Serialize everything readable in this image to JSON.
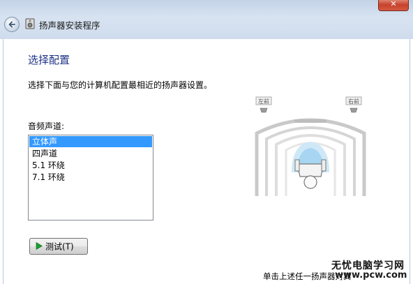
{
  "window": {
    "title": "扬声器安装程序",
    "close_glyph": "✕"
  },
  "page": {
    "heading": "选择配置",
    "instruction": "选择下面与您的计算机配置最相近的扬声器设置。",
    "channel_label": "音频声道:"
  },
  "channels": {
    "selected": "立体声",
    "options": [
      "立体声",
      "四声道",
      "5.1 环绕",
      "7.1 环绕"
    ]
  },
  "test_button": {
    "label": "测试(T)"
  },
  "diagram": {
    "left_label": "左前",
    "right_label": "右前"
  },
  "footer": {
    "hint": "单击上述任一扬声器对其"
  },
  "watermark": {
    "brand": "无忧电脑学习网",
    "url": "www.pcw.com"
  },
  "colors": {
    "accent": "#3399ff",
    "heading": "#1e3287",
    "close": "#c7422b"
  },
  "icons": {
    "back": "back-arrow-icon",
    "app": "speaker-setup-icon",
    "play": "play-icon"
  }
}
